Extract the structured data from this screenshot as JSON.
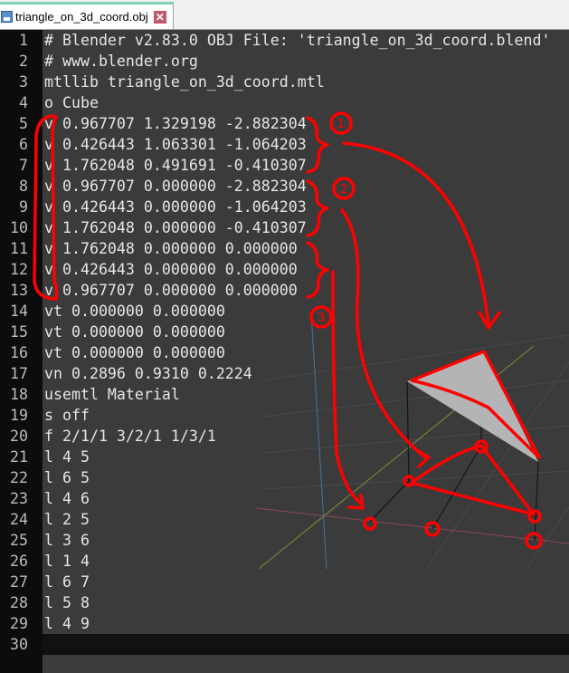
{
  "tab": {
    "title": "triangle_on_3d_coord.obj",
    "close": "✕"
  },
  "lines": [
    "# Blender v2.83.0 OBJ File: 'triangle_on_3d_coord.blend'",
    "# www.blender.org",
    "mtllib triangle_on_3d_coord.mtl",
    "o Cube",
    "v 0.967707 1.329198 -2.882304",
    "v 0.426443 1.063301 -1.064203",
    "v 1.762048 0.491691 -0.410307",
    "v 0.967707 0.000000 -2.882304",
    "v 0.426443 0.000000 -1.064203",
    "v 1.762048 0.000000 -0.410307",
    "v 1.762048 0.000000 0.000000",
    "v 0.426443 0.000000 0.000000",
    "v 0.967707 0.000000 0.000000",
    "vt 0.000000 0.000000",
    "vt 0.000000 0.000000",
    "vt 0.000000 0.000000",
    "vn 0.2896 0.9310 0.2224",
    "usemtl Material",
    "s off",
    "f 2/1/1 3/2/1 1/3/1",
    "l 4 5",
    "l 6 5",
    "l 4 6",
    "l 2 5",
    "l 3 6",
    "l 1 4",
    "l 6 7",
    "l 5 8",
    "l 4 9",
    ""
  ],
  "current_line": 30,
  "annotations": {
    "labels": [
      "1",
      "2",
      "3"
    ],
    "color": "#ff0000"
  }
}
